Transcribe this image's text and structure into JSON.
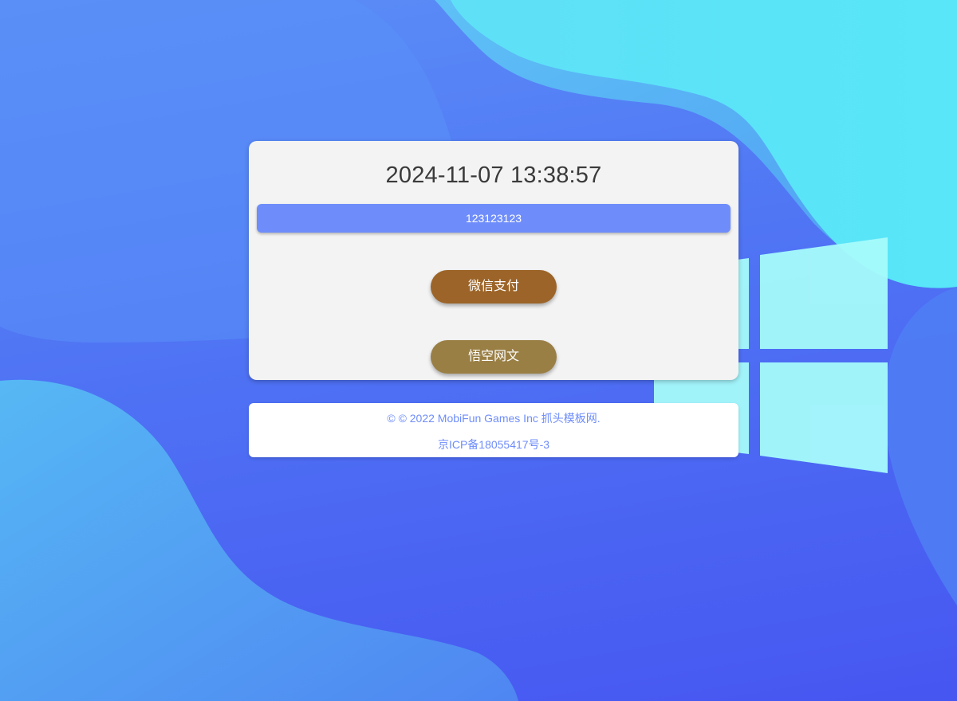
{
  "card": {
    "datetime": "2024-11-07 13:38:57",
    "notice": "123123123",
    "buttons": {
      "wechat_pay": "微信支付",
      "wukong": "悟空网文"
    }
  },
  "footer": {
    "copyright": "© © 2022 MobiFun Games Inc 抓头模板网.",
    "icp": "京ICP备18055417号-3"
  },
  "colors": {
    "notice_bar": "#6f8dfa",
    "wechat_button": "#9c6428",
    "wukong_button": "#9a7f45",
    "footer_text": "#6f8dfa"
  },
  "icons": {
    "background_logo": "windows-logo-icon"
  }
}
